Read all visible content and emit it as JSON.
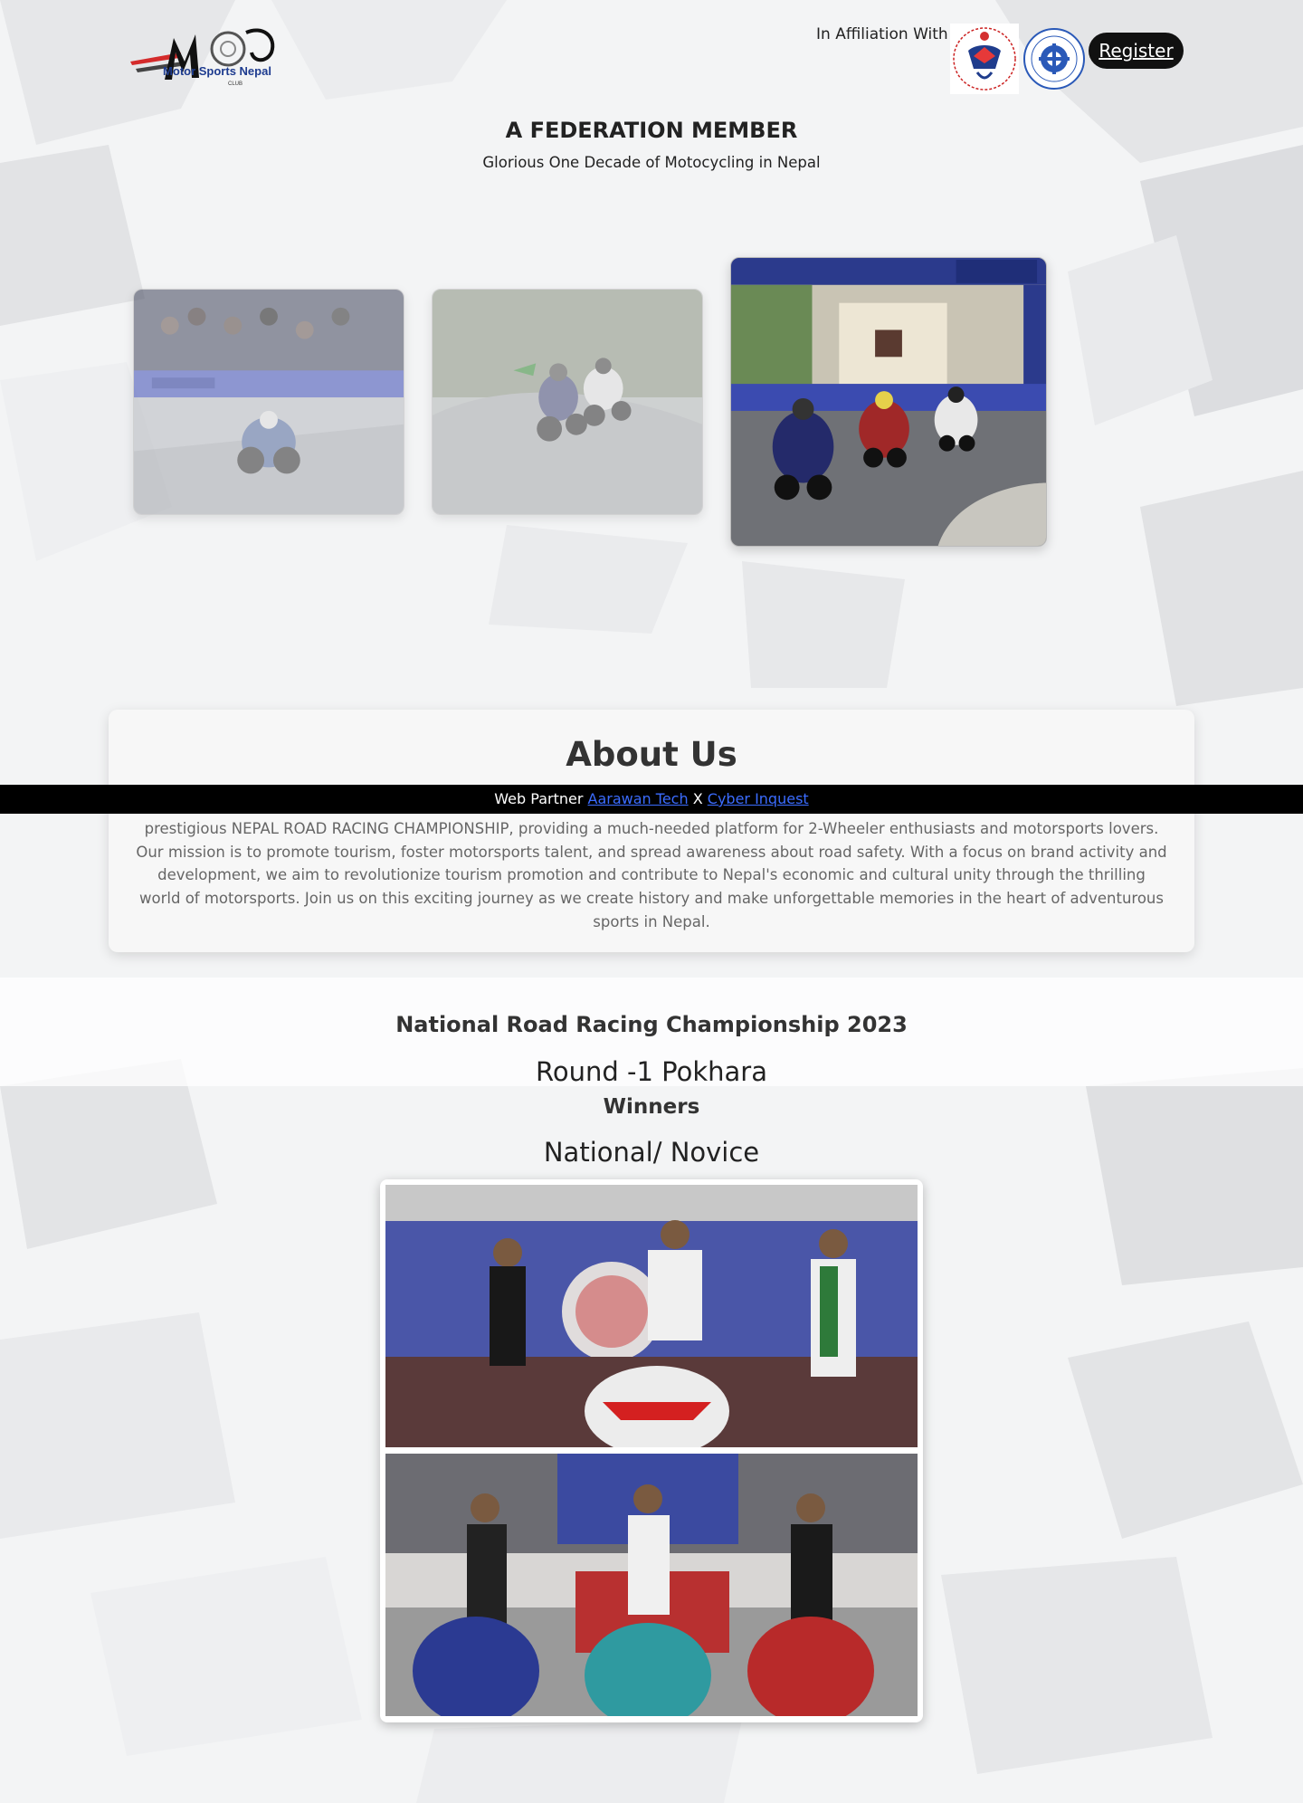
{
  "header": {
    "logo_text": "Motor Sports Nepal",
    "logo_subtext": "CLUB",
    "affiliation_label": "In Affiliation With",
    "register_label": "Register"
  },
  "hero": {
    "title": "A FEDERATION MEMBER",
    "subtitle": "Glorious One Decade of Motocycling in Nepal"
  },
  "carousel": {
    "images": [
      "race-photo-1",
      "race-photo-2",
      "race-photo-3"
    ],
    "active_index": 2
  },
  "about": {
    "title": "About Us",
    "text": "prestigious NEPAL ROAD RACING CHAMPIONSHIP, providing a much-needed platform for 2-Wheeler enthusiasts and motorsports lovers. Our mission is to promote tourism, foster motorsports talent, and spread awareness about road safety. With a focus on brand activity and development, we aim to revolutionize tourism promotion and contribute to Nepal's economic and cultural unity through the thrilling world of motorsports. Join us on this exciting journey as we create history and make unforgettable memories in the heart of adventurous sports in Nepal."
  },
  "web_partner": {
    "label": "Web Partner",
    "partner_1": "Aarawan Tech",
    "separator": "X",
    "partner_2": "Cyber Inquest"
  },
  "championship": {
    "title": "National Road Racing Championship 2023",
    "round": "Round -1 Pokhara",
    "winners_label": "Winners",
    "category": "National/ Novice"
  },
  "colors": {
    "accent_dark": "#111111",
    "link_blue": "#3b6cff",
    "partner_bar": "#000000"
  }
}
